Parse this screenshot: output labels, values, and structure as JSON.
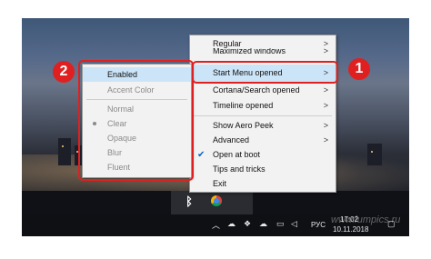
{
  "main_menu": {
    "items": [
      {
        "label": "Regular",
        "submenu": true
      },
      {
        "label": "Maximized windows",
        "submenu": true
      },
      {
        "label": "Start Menu opened",
        "submenu": true
      },
      {
        "label": "Cortana/Search opened",
        "submenu": true
      },
      {
        "label": "Timeline opened",
        "submenu": true
      },
      {
        "label": "Show Aero Peek",
        "submenu": true
      },
      {
        "label": "Advanced",
        "submenu": true
      },
      {
        "label": "Open at boot",
        "submenu": false
      },
      {
        "label": "Tips and tricks",
        "submenu": false
      },
      {
        "label": "Exit",
        "submenu": false
      }
    ],
    "arrow_glyph": ">",
    "check_glyph": "✔"
  },
  "submenu": {
    "items": [
      "Enabled",
      "Accent Color",
      "Normal",
      "Clear",
      "Opaque",
      "Blur",
      "Fluent"
    ]
  },
  "badges": {
    "one": "1",
    "two": "2"
  },
  "taskbar": {
    "language": "РУС",
    "time": "17:02",
    "date": "10.11.2018",
    "watermark": "www.lumpics.ru"
  },
  "icons": {
    "tray_up": "chevron-up-icon",
    "cloud": "cloud-icon",
    "dropbox": "dropbox-icon",
    "onedrive": "onedrive-icon",
    "network": "network-icon",
    "volume": "volume-icon",
    "notification": "notification-icon"
  },
  "colors": {
    "highlight": "#cce4f7",
    "annotation_red": "#e02020",
    "check_blue": "#0a64c8"
  }
}
